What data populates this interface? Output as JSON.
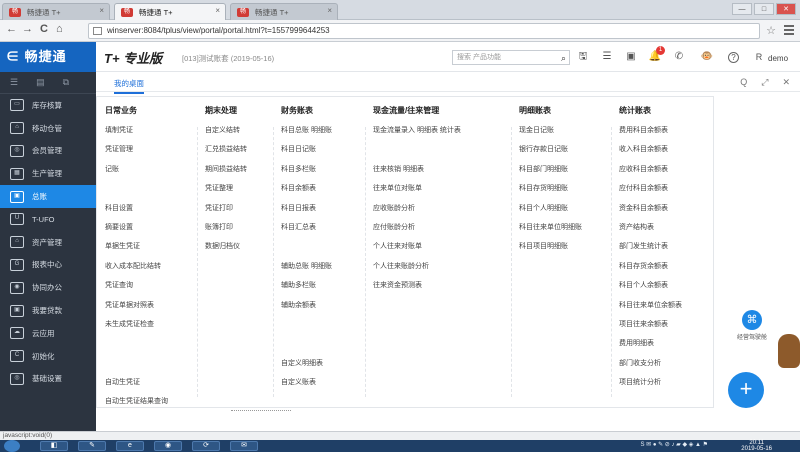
{
  "browser": {
    "tabs": [
      {
        "favicon": "畅",
        "label": "畅捷通 T+",
        "active": false
      },
      {
        "favicon": "畅",
        "label": "畅捷通 T+",
        "active": true
      },
      {
        "favicon": "畅",
        "label": "畅捷通 T+",
        "active": false
      }
    ],
    "tab_close": "×",
    "window_controls": [
      "—",
      "□",
      "✕"
    ],
    "nav": {
      "back": "←",
      "forward": "→",
      "reload": "C",
      "home": "⌂"
    },
    "url": "winserver:8084/tplus/view/portal/portal.html?t=1557999644253",
    "bookmark_star": "☆"
  },
  "header": {
    "logo": "∈ 畅捷通",
    "brand": "T+ 专业版",
    "account": "[013]测试账套 (2019-05-16)",
    "search_placeholder": "搜索 产品功能",
    "search_icon": "⌕",
    "icons": [
      {
        "name": "save-icon",
        "glyph": "🖫"
      },
      {
        "name": "settings-list-icon",
        "glyph": "☰"
      },
      {
        "name": "message-icon",
        "glyph": "▣"
      },
      {
        "name": "bell-icon",
        "glyph": "🔔"
      },
      {
        "name": "phone-icon",
        "glyph": "✆"
      },
      {
        "name": "mascot-icon",
        "glyph": "🐵"
      },
      {
        "name": "help-icon",
        "glyph": "?"
      }
    ],
    "notification_count": "1",
    "user": "demo",
    "user_icon": "R"
  },
  "sidebar": {
    "top_icons": [
      "☰",
      "▤",
      "⧉"
    ],
    "items": [
      {
        "icon": "▭",
        "label": "库存核算"
      },
      {
        "icon": "⌂",
        "label": "移动仓管"
      },
      {
        "icon": "◎",
        "label": "会员管理"
      },
      {
        "icon": "▦",
        "label": "生产管理"
      },
      {
        "icon": "▣",
        "label": "总账"
      },
      {
        "icon": "U",
        "label": "T-UFO"
      },
      {
        "icon": "⌂",
        "label": "资产管理"
      },
      {
        "icon": "G",
        "label": "报表中心"
      },
      {
        "icon": "◉",
        "label": "协同办公"
      },
      {
        "icon": "▣",
        "label": "我要贷款"
      },
      {
        "icon": "☁",
        "label": "云应用"
      },
      {
        "icon": "C",
        "label": "初始化"
      },
      {
        "icon": "◎",
        "label": "基础设置"
      }
    ],
    "active_index": 4
  },
  "main": {
    "subtab": "我的桌面",
    "subbar_icons": [
      "Q",
      "⤢",
      "✕"
    ],
    "columns": [
      {
        "title": "日常业务",
        "items": [
          "填制凭证",
          "凭证管理",
          "记账",
          "",
          "科目设置",
          "摘要设置",
          "单据生凭证",
          "收入成本配比结转",
          "凭证查询",
          "凭证单据对照表",
          "未生成凭证检查",
          "",
          "",
          "自动生凭证",
          "自动生凭证结果查询"
        ]
      },
      {
        "title": "期末处理",
        "items": [
          "自定义结转",
          "汇兑损益结转",
          "期间损益结转",
          "凭证整理",
          "凭证打印",
          "账簿打印",
          "数据归档仪"
        ]
      },
      {
        "title": "财务账表",
        "items": [
          "科目总账   明细账",
          "科目日记账",
          "科目多栏账",
          "科目余额表",
          "科目日报表",
          "科目汇总表",
          "",
          "辅助总账   明细账",
          "辅助多栏账",
          "辅助余额表",
          "",
          "",
          "自定义明细表",
          "自定义账表"
        ]
      },
      {
        "title": "现金流量/往来管理",
        "items": [
          "现金流量录入   明细表   统计表",
          "",
          "往来核销          明细表",
          "往来单位对账单",
          "应收账龄分析",
          "应付账龄分析",
          "个人往来对账单",
          "个人往来账龄分析",
          "往来资金预测表"
        ]
      },
      {
        "title": "明细账表",
        "items": [
          "现金日记账",
          "银行存款日记账",
          "科目部门明细账",
          "科目存货明细账",
          "科目个人明细账",
          "科目往来单位明细账",
          "科目项目明细账"
        ]
      },
      {
        "title": "统计账表",
        "items": [
          "费用科目余额表",
          "收入科目余额表",
          "应收科目余额表",
          "应付科目余额表",
          "资金科目余额表",
          "资产结构表",
          "部门发生统计表",
          "科目存货余额表",
          "科目个人余额表",
          "科目往来单位余额表",
          "项目往来余额表",
          "费用明细表",
          "部门收支分析",
          "项目统计分析"
        ]
      }
    ],
    "assistant_label": "经营驾驶舱",
    "assistant_icon": "⌘",
    "fab": "+"
  },
  "status_text": "javascript:void(0)",
  "taskbar": {
    "apps": [
      "◧",
      "✎",
      "e",
      "◉",
      "⟳",
      "✉"
    ],
    "tray": "S ✉ ● ✎ ⊘ ♪ ▰ ◆ ◈ ▲ ⚑",
    "time": "20:11",
    "date": "2019-05-16"
  }
}
